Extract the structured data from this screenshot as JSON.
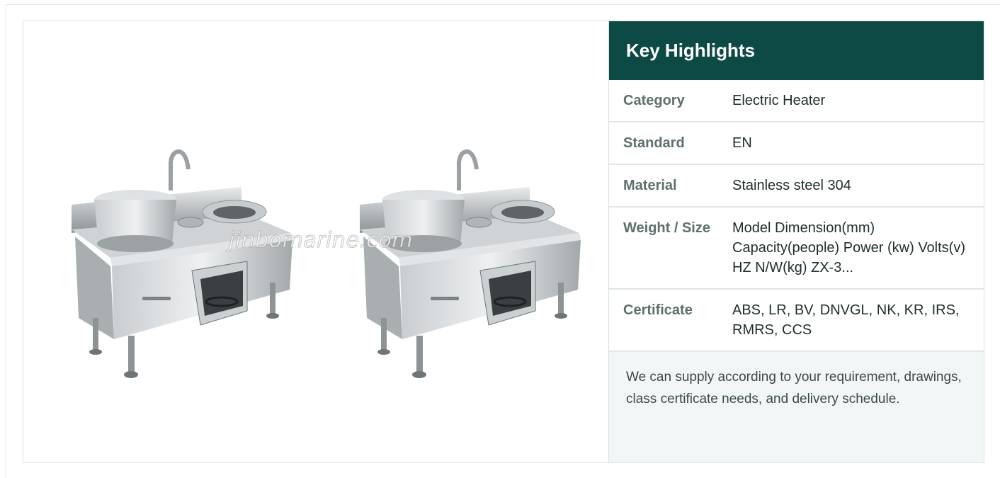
{
  "watermark": "jinbomarine.com",
  "highlights": {
    "title": "Key Highlights",
    "rows": [
      {
        "label": "Category",
        "value": "Electric Heater"
      },
      {
        "label": "Standard",
        "value": "EN"
      },
      {
        "label": "Material",
        "value": "Stainless steel 304"
      },
      {
        "label": "Weight / Size",
        "value": "Model Dimension(mm) Capacity(people) Power (kw) Volts(v) HZ N/W(kg) ZX-3..."
      },
      {
        "label": "Certificate",
        "value": "ABS, LR, BV, DNVGL, NK, KR, IRS, RMRS, CCS"
      }
    ],
    "note": "We can supply according to your requirement, drawings, class certificate needs, and delivery schedule."
  },
  "colors": {
    "header_bg": "#0e4a45",
    "note_bg": "#f3f6f6"
  }
}
